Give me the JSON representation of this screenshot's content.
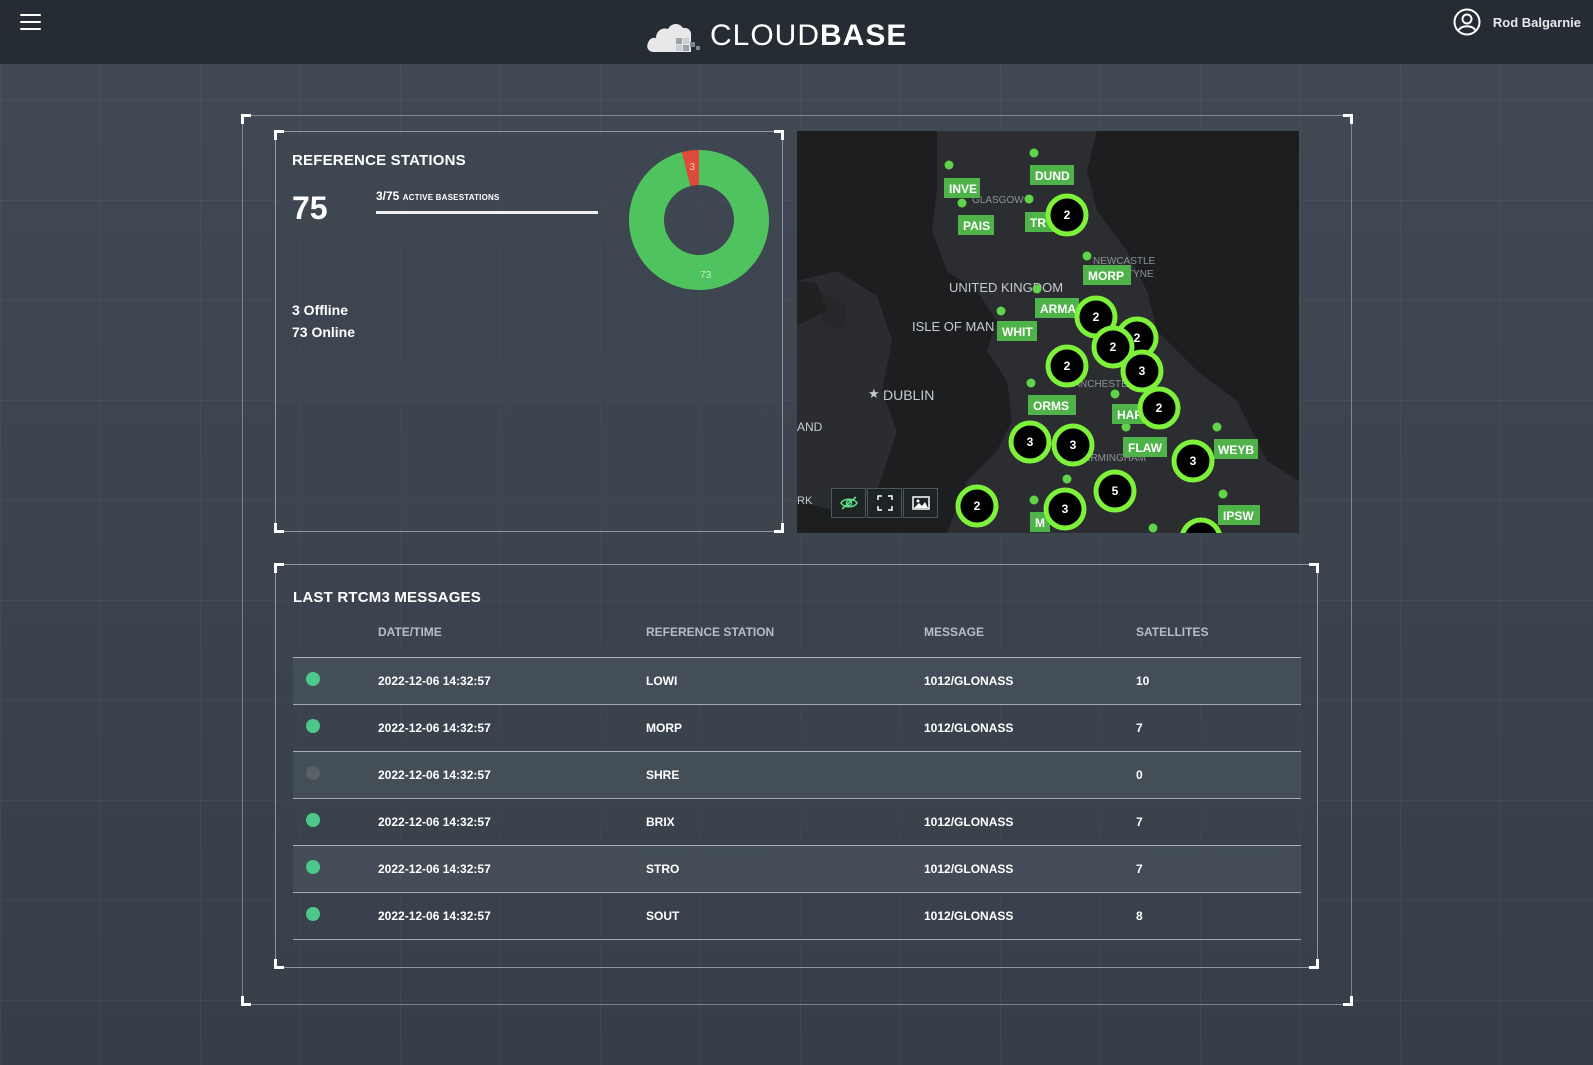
{
  "header": {
    "logo_light": "CLOUD",
    "logo_bold": "BASE",
    "user_name": "Rod Balgarnie",
    "menu_icon": "hamburger-icon",
    "user_icon": "user-circle-icon"
  },
  "stations": {
    "title": "REFERENCE STATIONS",
    "total": "75",
    "active_count": "3/75",
    "active_label": "ACTIVE BASESTATIONS",
    "active_fraction": 1.0,
    "offline_text": "3 Offline",
    "online_text": "73 Online",
    "donut": {
      "offline_value": 3,
      "online_value": 73,
      "offline_color": "#e04a3a",
      "online_color": "#4fc45e"
    }
  },
  "map": {
    "place_labels": [
      "GLASGOW",
      "NEWCASTLE",
      "TYNE",
      "UNITED KINGDOM",
      "ISLE OF MAN",
      "MANCHESTER",
      "DUBLIN",
      "BIRMINGHAM",
      "AND",
      "RK"
    ],
    "station_tags": [
      "INVE",
      "DUND",
      "PAIS",
      "TR",
      "MORP",
      "ARMA",
      "WHIT",
      "ORMS",
      "HAF",
      "FLAW",
      "WEYB",
      "IPSW",
      "M"
    ],
    "clusters": [
      "2",
      "2",
      "2",
      "2",
      "2",
      "3",
      "2",
      "3",
      "3",
      "3",
      "5",
      "3",
      "2"
    ],
    "tools": [
      "hide-icon",
      "fullscreen-icon",
      "image-icon"
    ],
    "marker_color": "#5fd34a"
  },
  "messages": {
    "title": "LAST RTCM3 MESSAGES",
    "columns": [
      "DATE/TIME",
      "REFERENCE STATION",
      "MESSAGE",
      "SATELLITES"
    ],
    "rows": [
      {
        "status": "online",
        "datetime": "2022-12-06 14:32:57",
        "station": "LOWI",
        "message": "1012/GLONASS",
        "satellites": "10"
      },
      {
        "status": "online",
        "datetime": "2022-12-06 14:32:57",
        "station": "MORP",
        "message": "1012/GLONASS",
        "satellites": "7"
      },
      {
        "status": "offline",
        "datetime": "2022-12-06 14:32:57",
        "station": "SHRE",
        "message": "",
        "satellites": "0"
      },
      {
        "status": "online",
        "datetime": "2022-12-06 14:32:57",
        "station": "BRIX",
        "message": "1012/GLONASS",
        "satellites": "7"
      },
      {
        "status": "online",
        "datetime": "2022-12-06 14:32:57",
        "station": "STRO",
        "message": "1012/GLONASS",
        "satellites": "7"
      },
      {
        "status": "online",
        "datetime": "2022-12-06 14:32:57",
        "station": "SOUT",
        "message": "1012/GLONASS",
        "satellites": "8"
      }
    ],
    "status_colors": {
      "online": "#4cc98a",
      "offline": "#5a6066"
    }
  }
}
